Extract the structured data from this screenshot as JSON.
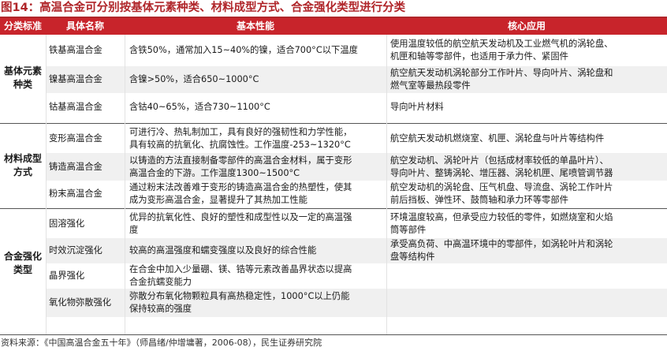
{
  "title": "图14：高温合金可分别按基体元素种类、材料成型方式、合金强化类型进行分类",
  "header": {
    "category": "分类标准",
    "name": "具体名称",
    "performance": "基本性能",
    "application": "核心应用"
  },
  "groups": [
    {
      "label_lines": [
        "基体元素",
        "种类"
      ],
      "rows": [
        {
          "name": "铁基高温合金",
          "performance": [
            "含铁50%，通常加入15~40%的镍，适合700°C以下温度"
          ],
          "application": [
            "使用温度较低的航空航天发动机及工业燃气机的涡轮盘、",
            "机匣和轴等零部件，也适用于承力件、紧固件"
          ]
        },
        {
          "name": "镍基高温合金",
          "performance": [
            "含镍>50%，适合650~1000°C"
          ],
          "application": [
            "航空航天发动机涡轮部分工作叶片、导向叶片、涡轮盘和",
            "燃气室等最热段零件"
          ]
        },
        {
          "name": "钴基高温合金",
          "performance": [
            "含钴40~65%，适合730~1100°C"
          ],
          "application": [
            "导向叶片材料"
          ]
        }
      ]
    },
    {
      "label_lines": [
        "材料成型",
        "方式"
      ],
      "rows": [
        {
          "name": "变形高温合金",
          "performance": [
            "可进行冷、热轧制加工，具有良好的强韧性和力学性能，",
            "具有较高的抗氧化、抗腐蚀性。工作温度-253~1320°C"
          ],
          "application": [
            "航空航天发动机燃烧室、机匣、涡轮盘与叶片等结构件"
          ]
        },
        {
          "name": "铸造高温合金",
          "performance": [
            "以铸造的方法直接制备零部件的高温合金材料，属于变形",
            "高温合金的下游。工作温度1300~1500°C"
          ],
          "application": [
            "航空发动机、涡轮叶片（包括成材率较低的单晶叶片）、",
            "导向叶片、整铸涡轮、增压器、涡轮机匣、尾喷管调节器"
          ]
        },
        {
          "name": "粉末高温合金",
          "performance": [
            "通过粉末法改善难于变形的铸造高温合金的热塑性，使其",
            "成为变形高温合金，显著提升了其热加工性能"
          ],
          "application": [
            "航空发动机的涡轮盘、压气机盘、导流盘、涡轮工作叶片",
            "前后挡板、弹性环、鼓筒轴和承力环等零部件"
          ]
        }
      ]
    },
    {
      "label_lines": [
        "合金强化",
        "类型"
      ],
      "rows": [
        {
          "name": "固溶强化",
          "performance": [
            "优异的抗氧化性、良好的塑性和成型性以及一定的高温强",
            "度"
          ],
          "application": [
            "环境温度较高，但承受应力较低的零件，如燃烧室和火焰",
            "筒等部件"
          ]
        },
        {
          "name": "时效沉淀强化",
          "performance": [
            "较高的高温强度和蠕变强度以及良好的综合性能"
          ],
          "application": [
            "承受高负荷、中高温环境中的零部件，如涡轮叶片和涡轮",
            "盘等结构件"
          ]
        },
        {
          "name": "晶界强化",
          "performance": [
            "在合金中加入少量硼、镁、锆等元素改善晶界状态以提高",
            "合金抗蠕变能力"
          ],
          "application": []
        },
        {
          "name": "氧化物弥散强化",
          "performance": [
            "弥散分布氧化物颗粒具有高热稳定性，1000°C以上仍能",
            "保持较高的强度"
          ],
          "application": []
        }
      ]
    }
  ],
  "source": "资料来源：《中国高温合金五十年》（师昌绪/仲增墉著，2006-08），民生证券研究院"
}
